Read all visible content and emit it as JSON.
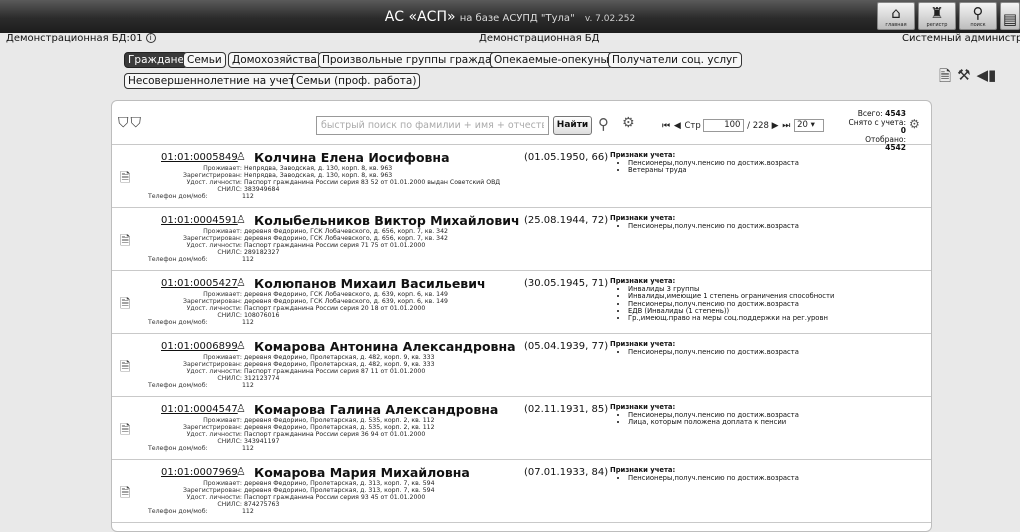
{
  "app": {
    "title_main": "АС «АСП»",
    "title_base": "на базе АСУПД \"Тула\"",
    "version": "v. 7.02.252",
    "top_buttons": [
      {
        "label": "главная",
        "icon": "home-icon"
      },
      {
        "label": "регистр",
        "icon": "registry-icon"
      },
      {
        "label": "поиск",
        "icon": "search-person-icon"
      }
    ]
  },
  "infobar": {
    "database": "Демонстрационная БД:01",
    "center_db": "Демонстрационная БД",
    "user": "Системный администрат"
  },
  "tabs": [
    {
      "label": "Граждане",
      "active": true
    },
    {
      "label": "Семьи"
    },
    {
      "label": "Домохозяйства"
    },
    {
      "label": "Произвольные группы граждан"
    },
    {
      "label": "Опекаемые-опекуны"
    },
    {
      "label": "Получатели соц. услуг"
    },
    {
      "label": "Несовершеннолетние на учете"
    },
    {
      "label": "Семьи (проф. работа)"
    }
  ],
  "search": {
    "placeholder": "быстрый поиск по фамилии + имя + отчество",
    "button": "Найти"
  },
  "pager": {
    "page_label": "Стр",
    "current": "100",
    "total": "/ 228",
    "page_size": "20"
  },
  "stats": {
    "total_label": "Всего:",
    "total": "4543",
    "removed_label": "Снято с учета:",
    "removed": "0",
    "selected_label": "Отобрано:",
    "selected": "4542"
  },
  "labels": {
    "lives": "Проживает:",
    "registered": "Зарегистрирован:",
    "id_doc": "Удост. личности:",
    "snils": "СНИЛС:",
    "phone": "Телефон дом/моб:",
    "signs": "Признаки учета:"
  },
  "records": [
    {
      "id": "01:01:0005849",
      "name": "Колчина Елена Иосифовна",
      "dob": "(01.05.1950, 66)",
      "lives": "Непрядва, Заводская, д. 130, корп. 8, кв. 963",
      "registered": "Непрядва, Заводская, д. 130, корп. 8, кв. 963",
      "id_doc": "Паспорт гражданина России серия 83 52 от 01.01.2000 выдан Советский ОВД",
      "snils": "383949684",
      "phone": "112",
      "signs": [
        "Пенсионеры,получ.пенсию по достиж.возраста",
        "Ветераны труда"
      ]
    },
    {
      "id": "01:01:0004591",
      "name": "Колыбельников Виктор Михайлович",
      "dob": "(25.08.1944, 72)",
      "lives": "деревня Федорино, ГСК Лобачевского, д. 656, корп. 7, кв. 342",
      "registered": "деревня Федорино, ГСК Лобачевского, д. 656, корп. 7, кв. 342",
      "id_doc": "Паспорт гражданина России серия 71 75 от 01.01.2000",
      "snils": "289182327",
      "phone": "112",
      "signs": [
        "Пенсионеры,получ.пенсию по достиж.возраста"
      ]
    },
    {
      "id": "01:01:0005427",
      "name": "Колюпанов Михаил Васильевич",
      "dob": "(30.05.1945, 71)",
      "lives": "деревня Федорино, ГСК Лобачевского, д. 639, корп. 6, кв. 149",
      "registered": "деревня Федорино, ГСК Лобачевского, д. 639, корп. 6, кв. 149",
      "id_doc": "Паспорт гражданина России серия 20 18 от 01.01.2000",
      "snils": "108076016",
      "phone": "112",
      "signs": [
        "Инвалиды 3 группы",
        "Инвалиды,имеющие 1 степень ограничения способности",
        "Пенсионеры,получ.пенсию по достиж.возраста",
        "ЕДВ (Инвалиды (1 степень))",
        "Гр.,имеющ.право на меры соц.поддержки на рег.уровн"
      ]
    },
    {
      "id": "01:01:0006899",
      "name": "Комарова Антонина Александровна",
      "dob": "(05.04.1939, 77)",
      "lives": "деревня Федорино, Пролетарская, д. 482, корп. 9, кв. 333",
      "registered": "деревня Федорино, Пролетарская, д. 482, корп. 9, кв. 333",
      "id_doc": "Паспорт гражданина России серия 87 11 от 01.01.2000",
      "snils": "312123774",
      "phone": "112",
      "signs": [
        "Пенсионеры,получ.пенсию по достиж.возраста"
      ]
    },
    {
      "id": "01:01:0004547",
      "name": "Комарова Галина Александровна",
      "dob": "(02.11.1931, 85)",
      "lives": "деревня Федорино, Пролетарская, д. 535, корп. 2, кв. 112",
      "registered": "деревня Федорино, Пролетарская, д. 535, корп. 2, кв. 112",
      "id_doc": "Паспорт гражданина России серия 36 94 от 01.01.2000",
      "snils": "343941197",
      "phone": "112",
      "signs": [
        "Пенсионеры,получ.пенсию по достиж.возраста",
        "Лица, которым положена доплата к пенсии"
      ]
    },
    {
      "id": "01:01:0007969",
      "name": "Комарова Мария Михайловна",
      "dob": "(07.01.1933, 84)",
      "lives": "деревня Федорино, Пролетарская, д. 313, корп. 7, кв. 594",
      "registered": "деревня Федорино, Пролетарская, д. 313, корп. 7, кв. 594",
      "id_doc": "Паспорт гражданина России серия 93 45 от 01.01.2000",
      "snils": "874275763",
      "phone": "112",
      "signs": [
        "Пенсионеры,получ.пенсию по достиж.возраста"
      ]
    }
  ]
}
